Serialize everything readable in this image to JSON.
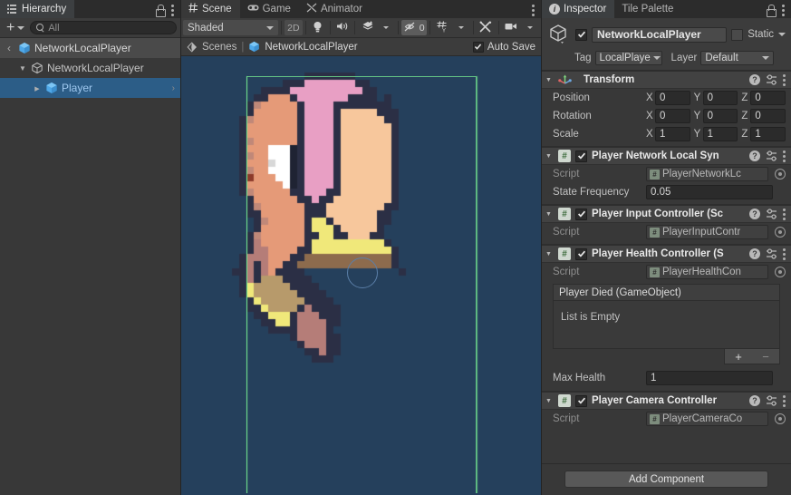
{
  "hierarchy": {
    "tab_label": "Hierarchy",
    "tab_icon": "hierarchy-icon",
    "toolbar": {
      "add_label": "+",
      "search_placeholder": "All",
      "search_value": ""
    },
    "breadcrumb": {
      "back": "‹",
      "label": "NetworkLocalPlayer"
    },
    "rows": [
      {
        "label": "NetworkLocalPlayer",
        "indent": 1,
        "twisty": "down",
        "icon": "prefab-outline-icon",
        "selected": false
      },
      {
        "label": "Player",
        "indent": 2,
        "twisty": "right",
        "icon": "prefab-cube-icon",
        "selected": true,
        "chev": "›"
      }
    ]
  },
  "scene": {
    "tabs": [
      {
        "label": "Scene",
        "icon": "grid-icon",
        "active": true
      },
      {
        "label": "Game",
        "icon": "gamepad-icon",
        "active": false
      },
      {
        "label": "Animator",
        "icon": "animator-icon",
        "active": false
      }
    ],
    "toolbar": {
      "shading_mode": "Shaded",
      "mode_2d": "2D",
      "lighting_icon": "lightbulb-icon",
      "audio_icon": "speaker-icon",
      "fx_icon": "effects-icon",
      "hidden_count": "0",
      "hidden_icon": "eye-off-icon",
      "grid_icon": "grid-snap-icon",
      "tools_icon": "scene-tools-icon",
      "camera_icon": "camera-icon"
    },
    "breadcrumb": {
      "root": "Scenes",
      "separator": "|",
      "scene_name": "NetworkLocalPlayer",
      "autosave_label": "Auto Save",
      "autosave_checked": true
    },
    "view": {
      "background_color": "#25405c",
      "gizmo_color": "#6fdc8c",
      "sprite_name": "pixel-art-character"
    }
  },
  "inspector": {
    "tabs": [
      {
        "label": "Inspector",
        "icon": "info-icon",
        "active": true
      },
      {
        "label": "Tile Palette",
        "icon": "",
        "active": false
      }
    ],
    "game_object": {
      "enabled": true,
      "name": "NetworkLocalPlayer",
      "static_label": "Static",
      "static_checked": false,
      "tag_label": "Tag",
      "tag_value": "LocalPlaye",
      "layer_label": "Layer",
      "layer_value": "Default"
    },
    "components": [
      {
        "title": "Transform",
        "icon": "transform-icon",
        "has_checkbox": false,
        "rows": [
          {
            "label": "Position",
            "type": "vector3",
            "x": "0",
            "y": "0",
            "z": "0"
          },
          {
            "label": "Rotation",
            "type": "vector3",
            "x": "0",
            "y": "0",
            "z": "0"
          },
          {
            "label": "Scale",
            "type": "vector3",
            "x": "1",
            "y": "1",
            "z": "1"
          }
        ]
      },
      {
        "title": "Player Network Local Syn",
        "icon": "script-icon",
        "has_checkbox": true,
        "enabled": true,
        "rows": [
          {
            "label": "Script",
            "type": "object",
            "value": "PlayerNetworkLc",
            "dim": true
          },
          {
            "label": "State Frequency",
            "type": "text",
            "value": "0.05"
          }
        ]
      },
      {
        "title": "Player Input Controller (Sc",
        "icon": "script-icon",
        "has_checkbox": true,
        "enabled": true,
        "rows": [
          {
            "label": "Script",
            "type": "object",
            "value": "PlayerInputContr",
            "dim": true
          }
        ]
      },
      {
        "title": "Player Health Controller (S",
        "icon": "script-icon",
        "has_checkbox": true,
        "enabled": true,
        "rows": [
          {
            "label": "Script",
            "type": "object",
            "value": "PlayerHealthCon",
            "dim": true
          }
        ],
        "event_list": {
          "header": "Player Died (GameObject)",
          "empty_text": "List is Empty",
          "add_label": "+",
          "remove_label": "−"
        },
        "rows_after": [
          {
            "label": "Max Health",
            "type": "text",
            "value": "1"
          }
        ]
      },
      {
        "title": "Player Camera Controller",
        "icon": "script-icon",
        "has_checkbox": true,
        "enabled": true,
        "rows": [
          {
            "label": "Script",
            "type": "object",
            "value": "PlayerCameraCo",
            "dim": true
          }
        ]
      }
    ],
    "add_component_label": "Add Component"
  },
  "chart_data": null
}
